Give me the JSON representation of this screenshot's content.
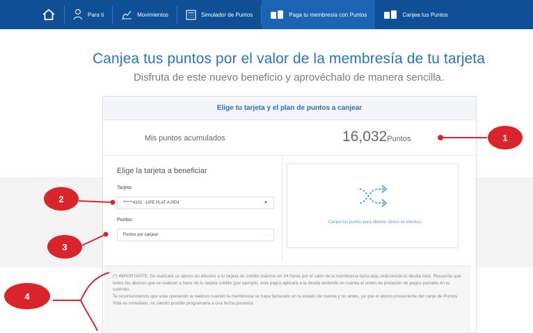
{
  "nav": {
    "home_icon": "home-icon",
    "items": [
      {
        "label": "Para ti",
        "icon": "person-icon"
      },
      {
        "label": "Movimientos",
        "icon": "chart-icon"
      },
      {
        "label": "Simulador de Puntos",
        "icon": "calculator-icon"
      },
      {
        "label": "Paga tu membresía con Puntos",
        "icon": "cards-icon"
      },
      {
        "label": "Canjea tus Puntos",
        "icon": "cards-icon"
      }
    ],
    "active_index": 3,
    "color": "#0e4f95"
  },
  "header": {
    "title": "Canjea tus puntos por el valor de la membresía de tu tarjeta",
    "subtitle": "Disfruta de este nuevo beneficio y aprovéchalo de manera sencilla."
  },
  "card": {
    "heading": "Elige tu tarjeta y el plan de puntos a canjear",
    "points_label": "Mis puntos acumulados",
    "points_value": "16,032",
    "points_unit": "Puntos"
  },
  "form": {
    "choose_label": "Elige la tarjeta a beneficiar",
    "card_field_label": "Tarjeta",
    "card_value": "******4101 - LIFE PLAT A PEN",
    "points_field_label": "Puntos",
    "points_placeholder": "Puntos por canjear"
  },
  "info_box": {
    "icon": "exchange-arrows-icon",
    "text": "Canjea tus puntos para obtener dinero en efectivo."
  },
  "notice": {
    "paragraph1": "(*) IMPORTANTE: Se realizará un abono en efectivo a tu tarjeta de crédito máximo en 24 horas por el valor de la membresía facturada, reduciendo tu deuda total. Recuerda que todos los abonos que se realicen a favor de tu tarjeta crédito (por ejemplo, este pago) aplicará a la deuda teniendo en cuenta el orden de prelación de pagos pactado en tu contrato.",
    "paragraph2": "Te recomendamos que esta operación la realices cuando la membresía se haya facturado en tu estado de cuenta y no antes, ya que el abono proveniente del canje de Puntos Vida es inmediato, no siendo posible programarla a una fecha posterior."
  },
  "annotations": {
    "labels": [
      "1",
      "2",
      "3",
      "4"
    ],
    "color": "#d8242a"
  }
}
